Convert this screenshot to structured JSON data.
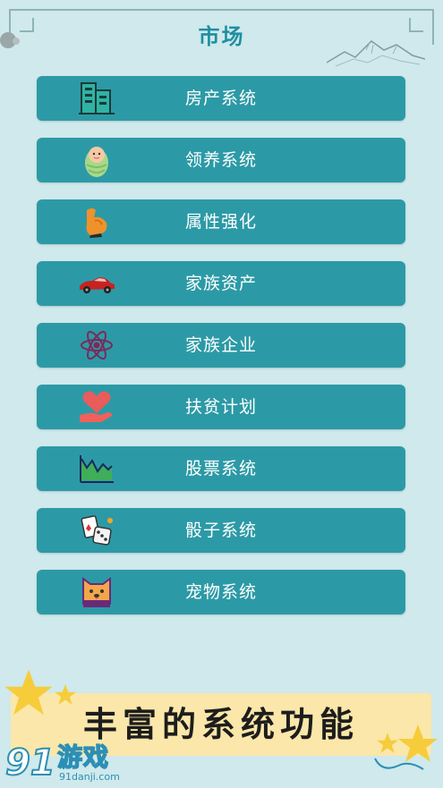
{
  "header": {
    "title": "市场"
  },
  "menu": {
    "items": [
      {
        "label": "房产系统",
        "icon": "building-icon"
      },
      {
        "label": "领养系统",
        "icon": "baby-icon"
      },
      {
        "label": "属性强化",
        "icon": "muscle-arm-icon"
      },
      {
        "label": "家族资产",
        "icon": "sports-car-icon"
      },
      {
        "label": "家族企业",
        "icon": "atom-icon"
      },
      {
        "label": "扶贫计划",
        "icon": "heart-hand-icon"
      },
      {
        "label": "股票系统",
        "icon": "stock-chart-icon"
      },
      {
        "label": "骰子系统",
        "icon": "dice-cards-icon"
      },
      {
        "label": "宠物系统",
        "icon": "pet-dog-icon"
      }
    ]
  },
  "banner": {
    "text": "丰富的系统功能"
  },
  "watermark": {
    "number": "91",
    "name": "游戏",
    "url": "91danji.com"
  },
  "colors": {
    "background": "#cfe9ec",
    "title": "#1f8fa0",
    "button": "#2c9aa6",
    "banner": "#fbe7a9"
  }
}
